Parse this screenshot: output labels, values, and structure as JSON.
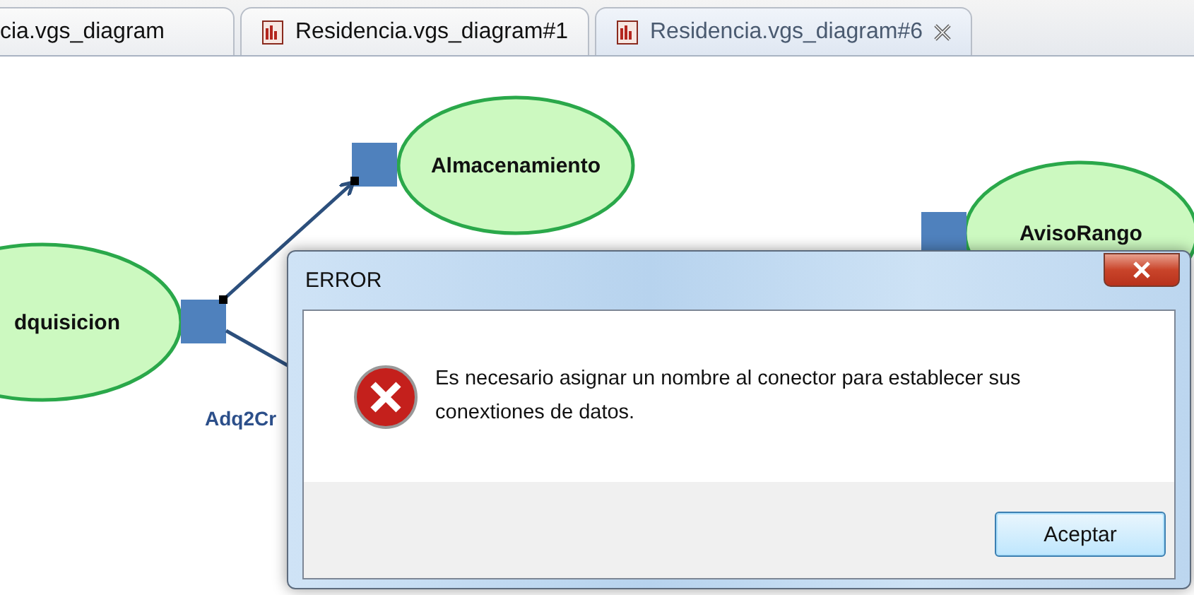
{
  "tabs": [
    {
      "label": "cia.vgs_diagram",
      "icon": false,
      "selected": false,
      "closable": false
    },
    {
      "label": "Residencia.vgs_diagram#1",
      "icon": true,
      "selected": false,
      "closable": false
    },
    {
      "label": "Residencia.vgs_diagram#6",
      "icon": true,
      "selected": true,
      "closable": true
    }
  ],
  "diagram": {
    "nodes": [
      {
        "label": "Almacenamiento"
      },
      {
        "label": "dquisicion"
      },
      {
        "label": "AvisoRango"
      }
    ],
    "connector_label": "Adq2Cr"
  },
  "dialog": {
    "title": "ERROR",
    "message": "Es necesario asignar un nombre al conector para establecer sus conextiones de datos.",
    "buttons": [
      "Aceptar"
    ]
  }
}
